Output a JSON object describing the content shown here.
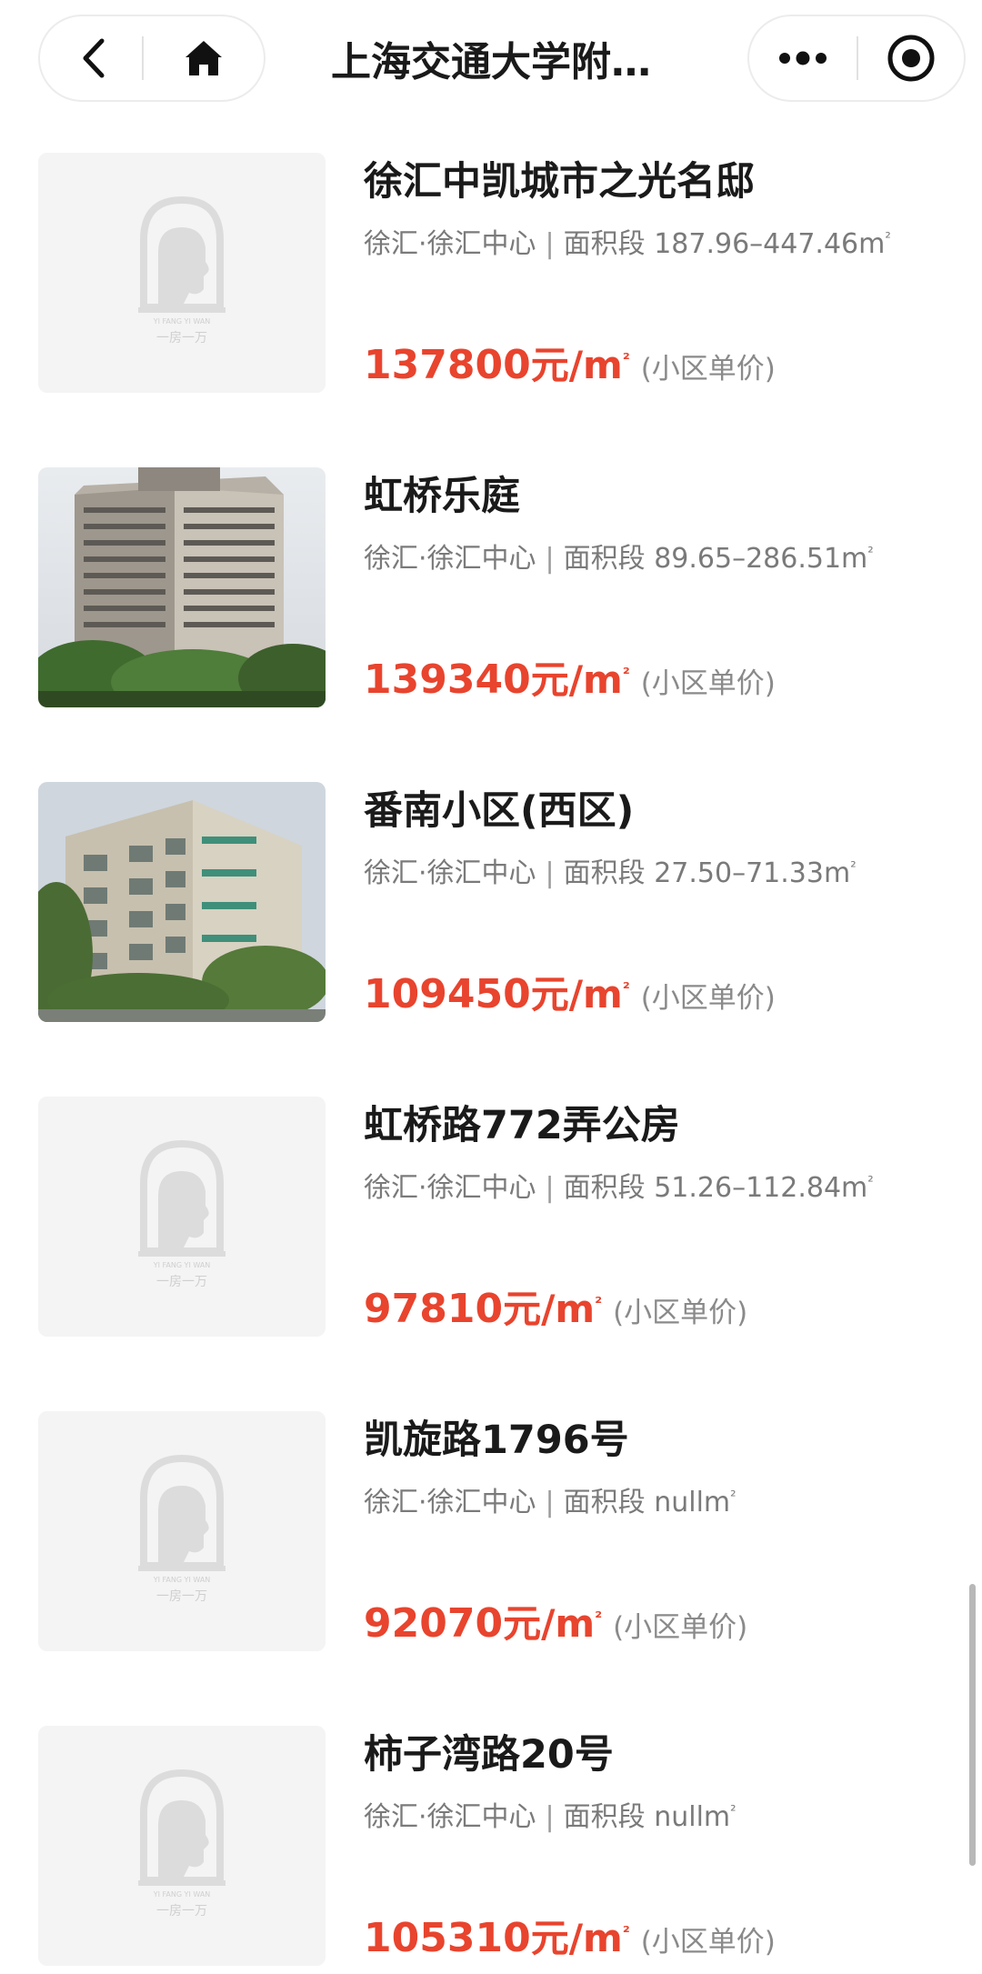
{
  "header": {
    "title": "上海交通大学附…",
    "back_icon": "chevron-left-icon",
    "home_icon": "home-icon",
    "more_icon": "more-dots-icon",
    "capsule_icon": "target-circle-icon"
  },
  "colors": {
    "price": "#e8442e",
    "title": "#1a1a1a",
    "meta": "#7a7a7a",
    "placeholder_bg": "#f4f4f4"
  },
  "listings": [
    {
      "name": "徐汇中凯城市之光名邸",
      "district": "徐汇·徐汇中心",
      "sep": "|",
      "area_label": "面积段",
      "area_value": "187.96–447.46m",
      "area_sup": "²",
      "price": "137800",
      "price_unit": "元/m",
      "price_sup": "²",
      "price_note": "(小区单价)",
      "image": "placeholder"
    },
    {
      "name": "虹桥乐庭",
      "district": "徐汇·徐汇中心",
      "sep": "|",
      "area_label": "面积段",
      "area_value": "89.65–286.51m",
      "area_sup": "²",
      "price": "139340",
      "price_unit": "元/m",
      "price_sup": "²",
      "price_note": "(小区单价)",
      "image": "photo-tower"
    },
    {
      "name": "番南小区(西区)",
      "district": "徐汇·徐汇中心",
      "sep": "|",
      "area_label": "面积段",
      "area_value": "27.50–71.33m",
      "area_sup": "²",
      "price": "109450",
      "price_unit": "元/m",
      "price_sup": "²",
      "price_note": "(小区单价)",
      "image": "photo-midrise"
    },
    {
      "name": "虹桥路772弄公房",
      "district": "徐汇·徐汇中心",
      "sep": "|",
      "area_label": "面积段",
      "area_value": "51.26–112.84m",
      "area_sup": "²",
      "price": "97810",
      "price_unit": "元/m",
      "price_sup": "²",
      "price_note": "(小区单价)",
      "image": "placeholder"
    },
    {
      "name": "凯旋路1796号",
      "district": "徐汇·徐汇中心",
      "sep": "|",
      "area_label": "面积段",
      "area_value": "nullm",
      "area_sup": "²",
      "price": "92070",
      "price_unit": "元/m",
      "price_sup": "²",
      "price_note": "(小区单价)",
      "image": "placeholder"
    },
    {
      "name": "柿子湾路20号",
      "district": "徐汇·徐汇中心",
      "sep": "|",
      "area_label": "面积段",
      "area_value": "nullm",
      "area_sup": "²",
      "price": "105310",
      "price_unit": "元/m",
      "price_sup": "²",
      "price_note": "(小区单价)",
      "image": "placeholder"
    }
  ],
  "placeholder_logo": {
    "caption_en": "YI FANG YI WAN",
    "caption_cn": "一房一万"
  }
}
